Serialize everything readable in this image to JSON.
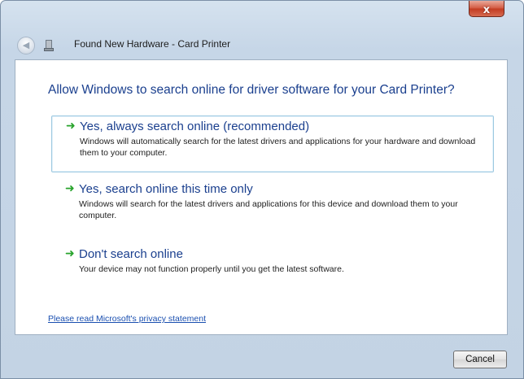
{
  "window": {
    "title": "Found New Hardware - Card Printer",
    "close_glyph": "x"
  },
  "icons": {
    "back": "back-arrow-icon",
    "hardware": "hardware-icon",
    "option_arrow": "green-arrow-icon",
    "option_arrow_color": "#27a32b"
  },
  "dialog": {
    "heading": "Allow Windows to search online for driver software for your Card Printer?",
    "options": [
      {
        "title": "Yes, always search online (recommended)",
        "description": "Windows will automatically search for the latest drivers and applications for your hardware and download them to your computer.",
        "selected": true
      },
      {
        "title": "Yes, search online this time only",
        "description": "Windows will search for the latest drivers and applications for this device and download them to your computer.",
        "selected": false
      },
      {
        "title": "Don't search online",
        "description": "Your device may not function properly until you get the latest software.",
        "selected": false
      }
    ],
    "privacy_link": "Please read Microsoft's privacy statement"
  },
  "footer": {
    "cancel_label": "Cancel"
  },
  "colors": {
    "heading": "#1a3f8e",
    "link": "#1a4fb0",
    "frame": "#c6d6e7"
  }
}
